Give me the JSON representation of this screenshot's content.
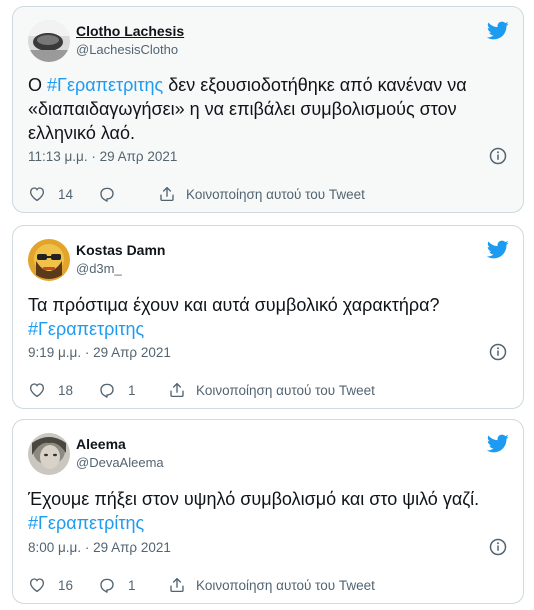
{
  "tweets": [
    {
      "author": "Clotho Lachesis",
      "handle": "@LachesisClotho",
      "text_parts": [
        "Ο ",
        "#Γεραπετριτης",
        " δεν εξουσιοδοτήθηκε από κανέναν να «διαπαιδαγωγήσει» η να επιβάλει συμβολισμούς στον ελληνικό λαό."
      ],
      "timestamp": "11:13 μ.μ. · 29 Απρ 2021",
      "likes": "14",
      "replies": "",
      "share_label": "Κοινοποίηση αυτού του Tweet"
    },
    {
      "author": "Kostas Damn",
      "handle": "@d3m_",
      "text_parts": [
        "Τα πρόστιμα έχουν και αυτά συμβολικό χαρακτήρα?",
        "#Γεραπετριτης"
      ],
      "timestamp": "9:19 μ.μ. · 29 Απρ 2021",
      "likes": "18",
      "replies": "1",
      "share_label": "Κοινοποίηση αυτού του Tweet"
    },
    {
      "author": "Aleema",
      "handle": "@DevaAleema",
      "text_parts": [
        "Έχουμε πήξει στον υψηλό συμβολισμό και στο ψιλό γαζί.",
        "#Γεραπετρίτης"
      ],
      "timestamp": "8:00 μ.μ. · 29 Απρ 2021",
      "likes": "16",
      "replies": "1",
      "share_label": "Κοινοποίηση αυτού του Tweet"
    }
  ],
  "colors": {
    "accent": "#1d9bf0",
    "text": "#0f1419",
    "secondary": "#536471",
    "border": "#cfd9de"
  },
  "icons": [
    "twitter-bird-icon",
    "info-icon",
    "heart-icon",
    "reply-icon",
    "share-icon"
  ]
}
